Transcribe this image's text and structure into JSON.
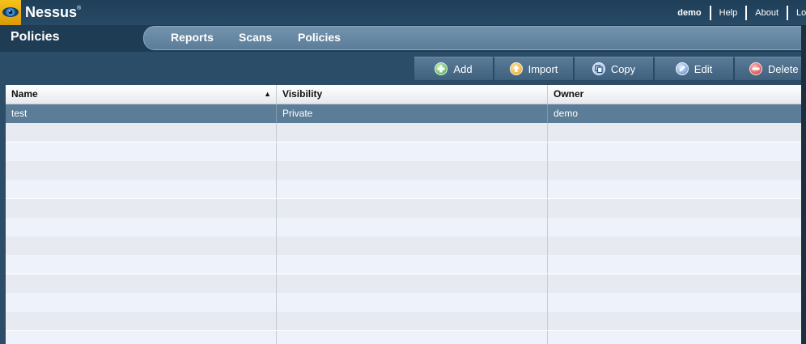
{
  "app": {
    "name": "Nessus",
    "trademark": "®"
  },
  "user_nav": {
    "user": "demo",
    "help": "Help",
    "about": "About",
    "logout": "Lo"
  },
  "nav": {
    "title": "Policies",
    "tabs": [
      {
        "label": "Reports"
      },
      {
        "label": "Scans"
      },
      {
        "label": "Policies"
      }
    ]
  },
  "toolbar": {
    "add": "Add",
    "import": "Import",
    "copy": "Copy",
    "edit": "Edit",
    "delete": "Delete"
  },
  "table": {
    "columns": [
      {
        "label": "Name",
        "sort": "ascending"
      },
      {
        "label": "Visibility"
      },
      {
        "label": "Owner"
      }
    ],
    "rows": [
      {
        "name": "test",
        "visibility": "Private",
        "owner": "demo",
        "selected": true
      }
    ]
  },
  "colors": {
    "accent": "#f6c21c",
    "header_bg": "#2c4d68",
    "selected_row": "#5b7d97"
  },
  "icons": [
    "nessus-eye-icon",
    "plus-icon",
    "upload-icon",
    "copy-icon",
    "pencil-icon",
    "minus-icon",
    "sort-asc-icon"
  ]
}
